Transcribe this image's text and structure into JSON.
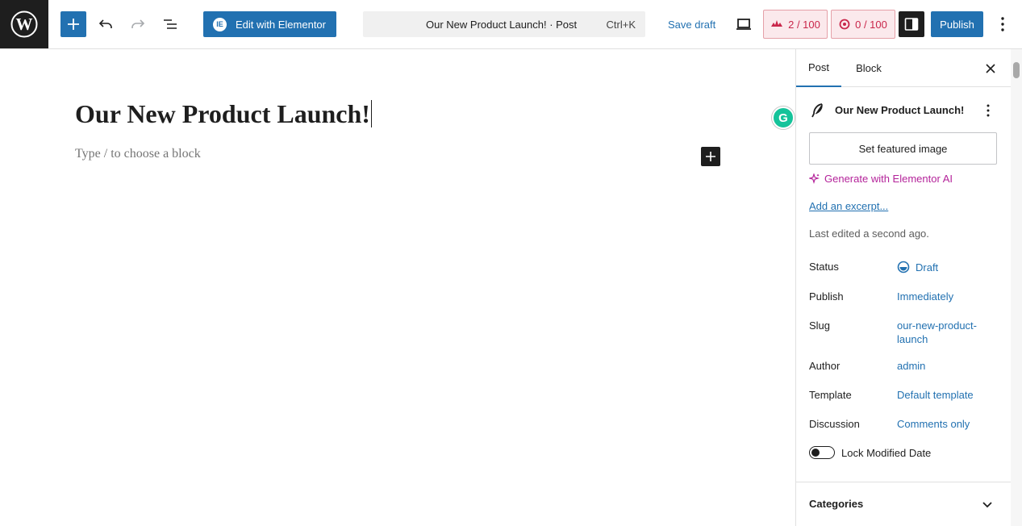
{
  "toolbar": {
    "elementor_label": "Edit with Elementor",
    "command_title": "Our New Product Launch! · Post",
    "command_shortcut": "Ctrl+K",
    "save_draft_label": "Save draft",
    "seo_score_1": "2 / 100",
    "seo_score_2": "0 / 100",
    "publish_label": "Publish"
  },
  "editor": {
    "title": "Our New Product Launch!",
    "block_placeholder": "Type / to choose a block",
    "grammarly_letter": "G"
  },
  "sidebar": {
    "tabs": [
      {
        "label": "Post"
      },
      {
        "label": "Block"
      }
    ],
    "post_name": "Our New Product Launch!",
    "featured_image_label": "Set featured image",
    "generate_ai_label": "Generate with Elementor AI",
    "add_excerpt_label": "Add an excerpt...",
    "last_edited": "Last edited a second ago.",
    "meta": [
      {
        "label": "Status",
        "value": "Draft"
      },
      {
        "label": "Publish",
        "value": "Immediately"
      },
      {
        "label": "Slug",
        "value": "our-new-product-\nlaunch"
      },
      {
        "label": "Author",
        "value": "admin"
      },
      {
        "label": "Template",
        "value": "Default template"
      },
      {
        "label": "Discussion",
        "value": "Comments only"
      }
    ],
    "lock_modified_label": "Lock Modified Date",
    "lock_modified_on": false,
    "categories_label": "Categories"
  },
  "colors": {
    "accent": "#2271b1",
    "score_red": "#c9264a",
    "ai_purple": "#b4239a",
    "grammarly": "#15c39a"
  }
}
